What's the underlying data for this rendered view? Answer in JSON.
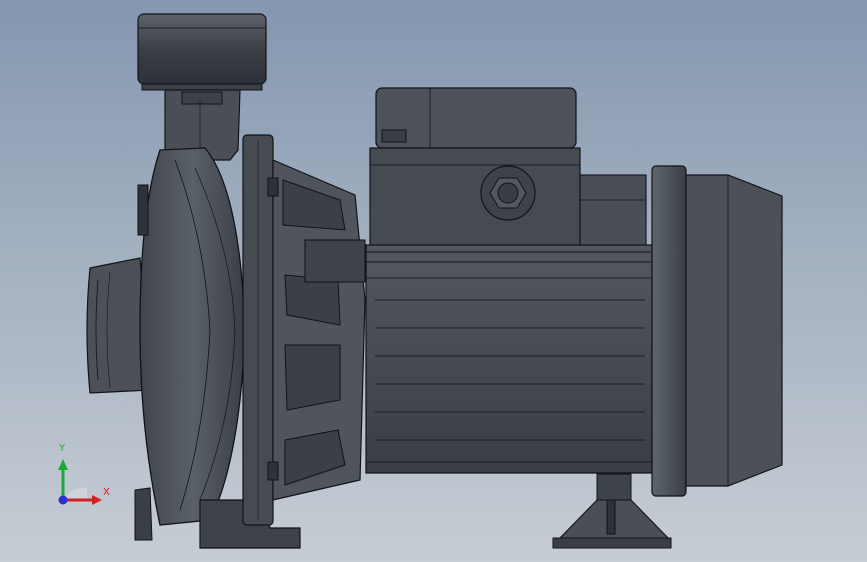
{
  "viewport": {
    "background_top": "#8497b0",
    "background_bottom": "#c7cdd4",
    "model": "centrifugal-pump-assembly",
    "display_mode": "shaded-with-edges"
  },
  "triad": {
    "x_label": "X",
    "y_label": "Y",
    "x_color": "#d42020",
    "y_color": "#1fa83a",
    "z_color": "#2b2fd0"
  },
  "colors": {
    "body_dark": "#3b3f46",
    "body_mid": "#4e535b",
    "body_light": "#6a7078",
    "edge": "#111317"
  }
}
